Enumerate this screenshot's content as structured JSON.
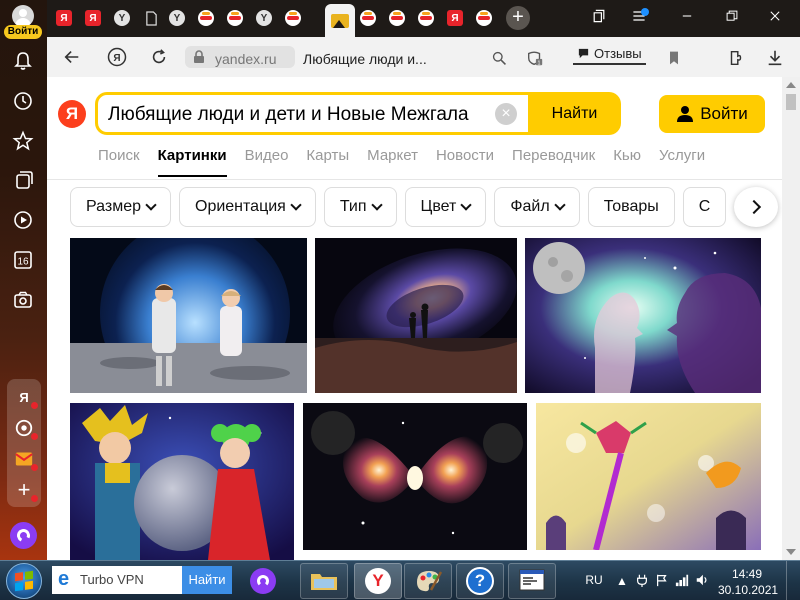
{
  "sidebar": {
    "login_badge": "Войти",
    "calendar_day": "16",
    "apps": [
      {
        "name": "yandex-app",
        "glyph": "Я"
      },
      {
        "name": "music-app",
        "glyph": "◎"
      },
      {
        "name": "mail-app",
        "glyph": "M"
      },
      {
        "name": "add-app",
        "glyph": "+"
      }
    ]
  },
  "tabs": [
    {
      "icon": "yandex-tab-icon",
      "kind": "ya",
      "glyph": "Я"
    },
    {
      "icon": "yandex-tab-icon",
      "kind": "ya",
      "glyph": "Я"
    },
    {
      "icon": "yandex-browser-tab-icon",
      "kind": "yb",
      "glyph": "Y"
    },
    {
      "icon": "document-tab-icon",
      "kind": "doc",
      "glyph": ""
    },
    {
      "icon": "yandex-browser-tab-icon",
      "kind": "yb",
      "glyph": "Y"
    },
    {
      "icon": "turbo-tab-icon",
      "kind": "turbo",
      "glyph": ""
    },
    {
      "icon": "turbo-tab-icon",
      "kind": "turbo",
      "glyph": ""
    },
    {
      "icon": "yandex-browser-tab-icon",
      "kind": "yb",
      "glyph": "Y"
    },
    {
      "icon": "turbo-tab-icon",
      "kind": "turbo",
      "glyph": ""
    },
    {
      "icon": "images-tab-icon",
      "kind": "img",
      "glyph": "",
      "active": true
    },
    {
      "icon": "turbo-tab-icon",
      "kind": "turbo",
      "glyph": ""
    },
    {
      "icon": "turbo-tab-icon",
      "kind": "turbo",
      "glyph": ""
    },
    {
      "icon": "turbo-tab-icon",
      "kind": "turbo",
      "glyph": ""
    },
    {
      "icon": "yandex-tab-icon",
      "kind": "ya",
      "glyph": "Я"
    },
    {
      "icon": "turbo-tab-icon",
      "kind": "turbo",
      "glyph": ""
    }
  ],
  "address": {
    "domain": "yandex.ru",
    "title": "Любящие люди и...",
    "reviews_label": "Отзывы"
  },
  "search": {
    "logo": "Я",
    "query": "Любящие люди и дети и Новые Межгала",
    "submit_label": "Найти",
    "login_label": "Войти"
  },
  "services": [
    {
      "label": "Поиск",
      "active": false
    },
    {
      "label": "Картинки",
      "active": true
    },
    {
      "label": "Видео",
      "active": false
    },
    {
      "label": "Карты",
      "active": false
    },
    {
      "label": "Маркет",
      "active": false
    },
    {
      "label": "Новости",
      "active": false
    },
    {
      "label": "Переводчик",
      "active": false
    },
    {
      "label": "Кью",
      "active": false
    },
    {
      "label": "Услуги",
      "active": false
    }
  ],
  "filters": [
    {
      "label": "Размер",
      "dropdown": true
    },
    {
      "label": "Ориентация",
      "dropdown": true
    },
    {
      "label": "Тип",
      "dropdown": true
    },
    {
      "label": "Цвет",
      "dropdown": true
    },
    {
      "label": "Файл",
      "dropdown": true
    },
    {
      "label": "Товары",
      "dropdown": false
    },
    {
      "label": "С",
      "dropdown": false
    }
  ],
  "images": [
    {
      "name": "result-image-kids-astronauts-moon"
    },
    {
      "name": "result-image-couple-galaxy"
    },
    {
      "name": "result-image-couple-silhouettes-moon"
    },
    {
      "name": "result-image-kids-planet-costume"
    },
    {
      "name": "result-image-butterfly-nebula"
    },
    {
      "name": "result-image-children-fantasy-lights"
    }
  ],
  "taskbar": {
    "search_text": "Turbo VPN",
    "search_button": "Найти",
    "language": "RU",
    "time": "14:49",
    "date": "30.10.2021"
  },
  "colors": {
    "yandex_yellow": "#ffcc00",
    "yandex_red": "#fc3f1d",
    "alice_purple": "#8b3cf3"
  }
}
